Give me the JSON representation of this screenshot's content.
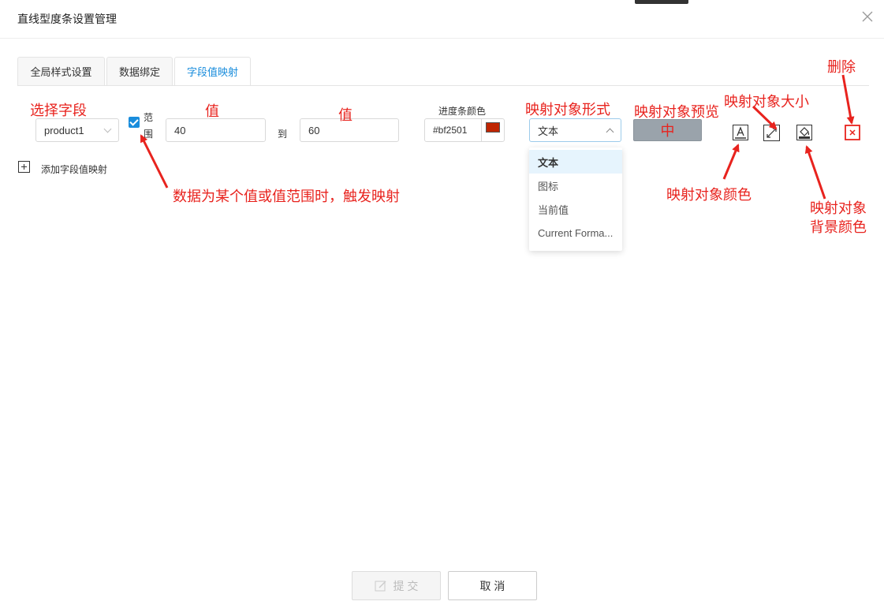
{
  "dialog": {
    "title": "直线型度条设置管理"
  },
  "tabs": [
    {
      "label": "全局样式设置",
      "active": false
    },
    {
      "label": "数据绑定",
      "active": false
    },
    {
      "label": "字段值映射",
      "active": true
    }
  ],
  "mapping_row": {
    "field_select": {
      "value": "product1"
    },
    "range_checkbox": {
      "checked": true,
      "label_line1": "范",
      "label_line2": "围"
    },
    "value_from": "40",
    "to_label": "到",
    "value_to": "60",
    "progress_color_label": "进度条颜色",
    "progress_color_value": "#bf2501",
    "progress_color_hex": "#bf2501",
    "mapping_type_select": {
      "value": "文本",
      "open": true
    },
    "preview_text": "中",
    "preview_bg": "#9aa3ab",
    "preview_color": "#e8231e"
  },
  "mapping_type_options": [
    {
      "label": "文本",
      "selected": true
    },
    {
      "label": "图标",
      "selected": false
    },
    {
      "label": "当前值",
      "selected": false
    },
    {
      "label": "Current Forma...",
      "selected": false
    }
  ],
  "add_mapping_label": "添加字段值映射",
  "annotations": {
    "select_field": "选择字段",
    "value1": "值",
    "value2": "值",
    "mapping_form": "映射对象形式",
    "mapping_preview": "映射对象预览",
    "mapping_size": "映射对象大小",
    "delete": "删除",
    "range_trigger": "数据为某个值或值范围时，触发映射",
    "mapping_color": "映射对象颜色",
    "mapping_bg_line1": "映射对象",
    "mapping_bg_line2": "背景颜色"
  },
  "icons": {
    "close": "close-icon",
    "font_color": "font-color-icon",
    "resize": "resize-icon",
    "bg_fill": "paint-bucket-icon",
    "delete": "delete-icon",
    "add": "plus-square-icon",
    "submit": "edit-icon"
  },
  "footer": {
    "submit_label": "提 交",
    "cancel_label": "取 消"
  },
  "colors": {
    "accent": "#1a8ddc",
    "annotation": "#e8231e"
  }
}
